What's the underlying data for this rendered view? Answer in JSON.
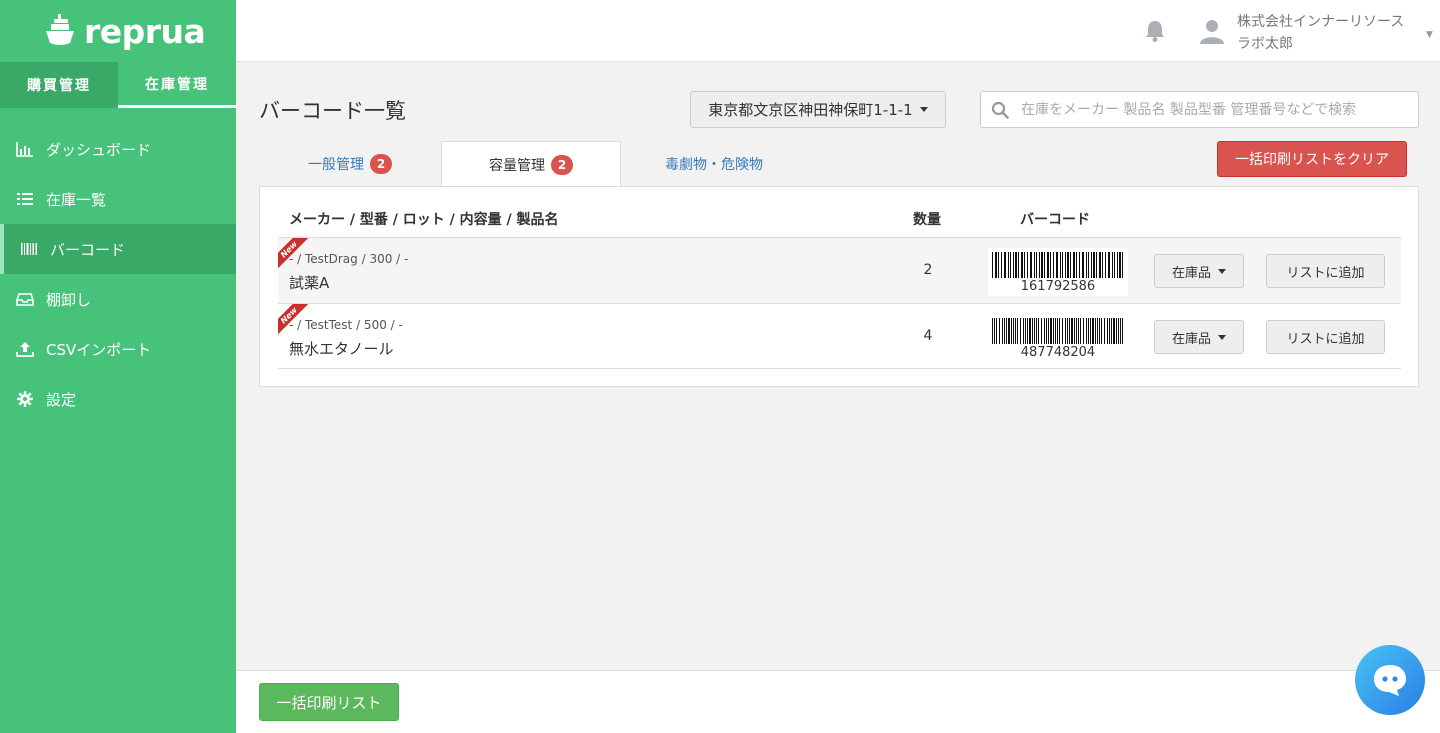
{
  "brand": {
    "name": "reprua"
  },
  "mode_tabs": [
    {
      "label": "購買管理"
    },
    {
      "label": "在庫管理"
    }
  ],
  "nav": {
    "items": [
      {
        "label": "ダッシュボード",
        "icon": "bar-chart-icon"
      },
      {
        "label": "在庫一覧",
        "icon": "list-icon"
      },
      {
        "label": "バーコード",
        "icon": "barcode-icon"
      },
      {
        "label": "棚卸し",
        "icon": "inbox-icon"
      },
      {
        "label": "CSVインポート",
        "icon": "upload-icon"
      },
      {
        "label": "設定",
        "icon": "gear-icon"
      }
    ],
    "active_index": 2
  },
  "header": {
    "company": "株式会社インナーリソース",
    "user": "ラボ太郎",
    "icons": [
      "bell-icon",
      "user-avatar-icon",
      "caret-down-icon"
    ]
  },
  "page": {
    "title": "バーコード一覧",
    "location_select": "東京都文京区神田神保町1-1-1",
    "search_placeholder": "在庫をメーカー 製品名 製品型番 管理番号などで検索",
    "clear_button": "一括印刷リストをクリア"
  },
  "tabs": [
    {
      "label": "一般管理",
      "badge": "2"
    },
    {
      "label": "容量管理",
      "badge": "2"
    },
    {
      "label": "毒劇物・危険物"
    }
  ],
  "active_tab": 1,
  "table": {
    "headers": {
      "product": "メーカー / 型番 / ロット / 内容量 / 製品名",
      "qty": "数量",
      "barcode": "バーコード"
    },
    "rows": [
      {
        "ribbon": "New",
        "meta": "- / TestDrag / 300 / -",
        "name": "試薬A",
        "qty": "2",
        "barcode": "161792586",
        "stock_button": "在庫品",
        "add_button": "リストに追加"
      },
      {
        "ribbon": "New",
        "meta": "- / TestTest / 500 / -",
        "name": "無水エタノール",
        "qty": "4",
        "barcode": "487748204",
        "stock_button": "在庫品",
        "add_button": "リストに追加"
      }
    ]
  },
  "footer": {
    "print_button": "一括印刷リスト"
  },
  "colors": {
    "sidebar": "#47c27b",
    "sidebar_dark": "#3aa866",
    "danger": "#d9534f",
    "success": "#5cb85c",
    "link": "#337ab7"
  }
}
